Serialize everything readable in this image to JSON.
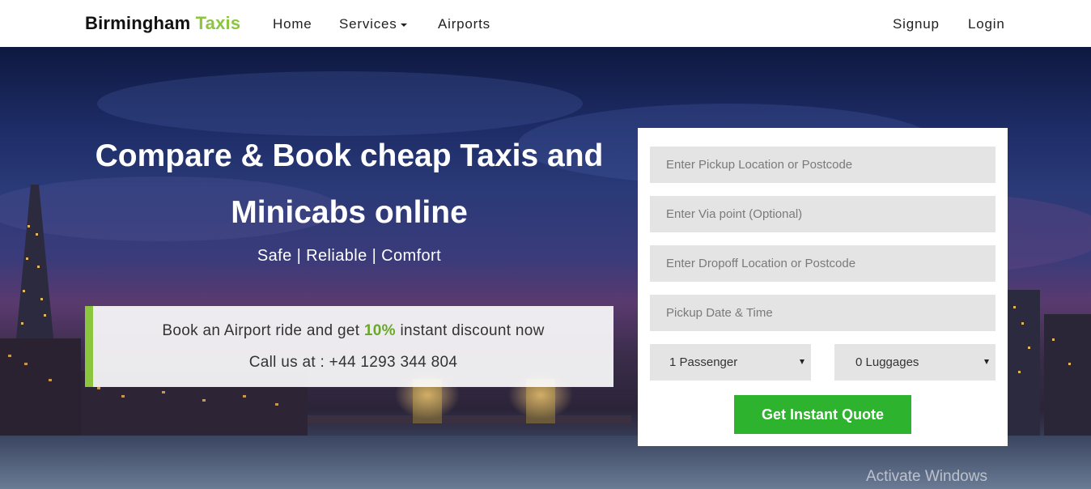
{
  "brand": {
    "name": "Birmingham",
    "accent": "Taxis",
    "accent_color": "#8cc63f"
  },
  "nav": {
    "home": "Home",
    "services": "Services",
    "airports": "Airports",
    "signup": "Signup",
    "login": "Login"
  },
  "hero": {
    "title_line1": "Compare & Book cheap Taxis and",
    "title_line2": "Minicabs online",
    "tagline": "Safe | Reliable | Comfort"
  },
  "promo": {
    "text_before": "Book an Airport ride and get",
    "discount": "10%",
    "text_after": "instant discount now",
    "phone_line": "Call us at : +44 1293 344 804"
  },
  "quote_form": {
    "pickup_placeholder": "Enter Pickup Location or Postcode",
    "via_placeholder": "Enter Via point (Optional)",
    "dropoff_placeholder": "Enter Dropoff Location or Postcode",
    "datetime_placeholder": "Pickup Date & Time",
    "passengers_selected": "1 Passenger",
    "luggages_selected": "0 Luggages",
    "submit_label": "Get Instant Quote",
    "button_color": "#2db32d"
  },
  "os_overlay": {
    "watermark": "Activate Windows"
  }
}
